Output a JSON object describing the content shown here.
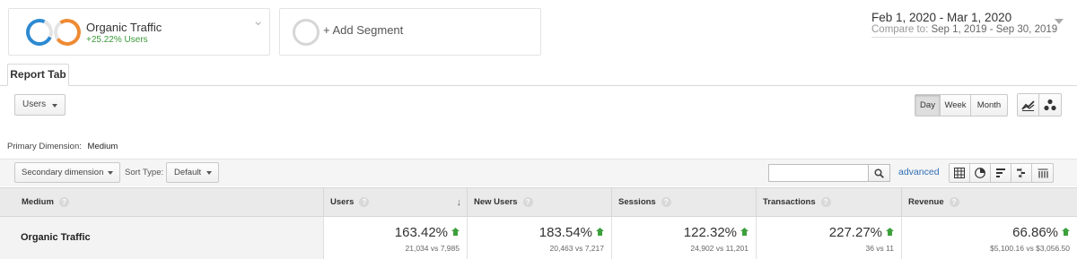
{
  "segments": {
    "primary": {
      "name": "Organic Traffic",
      "change": "+25.22% Users"
    },
    "add_label": "+ Add Segment"
  },
  "date": {
    "range": "Feb 1, 2020 - Mar 1, 2020",
    "compare_label": "Compare to:",
    "compare_range": "Sep 1, 2019 - Sep 30, 2019"
  },
  "report_tab": "Report Tab",
  "metric_select": "Users",
  "time_buttons": {
    "day": "Day",
    "week": "Week",
    "month": "Month",
    "selected": "Day"
  },
  "primary_dimension": {
    "label": "Primary Dimension:",
    "value": "Medium"
  },
  "toolbar": {
    "secondary_dimension": "Secondary dimension",
    "sort_type_label": "Sort Type:",
    "sort_type_value": "Default",
    "search_value": "",
    "advanced": "advanced"
  },
  "table": {
    "columns": {
      "medium": "Medium",
      "users": "Users",
      "new_users": "New Users",
      "sessions": "Sessions",
      "transactions": "Transactions",
      "revenue": "Revenue"
    },
    "row": {
      "label": "Organic Traffic",
      "users": {
        "pct": "163.42%",
        "compare": "21,034 vs 7,985"
      },
      "new_users": {
        "pct": "183.54%",
        "compare": "20,463 vs 7,217"
      },
      "sessions": {
        "pct": "122.32%",
        "compare": "24,902 vs 11,201"
      },
      "transactions": {
        "pct": "227.27%",
        "compare": "36 vs 11"
      },
      "revenue": {
        "pct": "66.86%",
        "compare": "$5,100.16 vs $3,056.50"
      }
    }
  },
  "colors": {
    "segment_blue": "#2d8ad1",
    "segment_orange": "#ee8a33",
    "positive_green": "#3da03d",
    "link_blue": "#2f6fb5"
  },
  "icons": {
    "segment_menu": "chevron-down-icon",
    "date_menu": "caret-down-icon",
    "line_chart": "line-chart-icon",
    "motion_chart": "motion-chart-icon",
    "search": "search-icon",
    "help": "help-icon",
    "sort": "sort-descending-arrow-icon",
    "increase": "up-arrow-icon",
    "views": [
      "table-view-icon",
      "pie-view-icon",
      "performance-view-icon",
      "comparison-view-icon",
      "pivot-view-icon"
    ]
  }
}
